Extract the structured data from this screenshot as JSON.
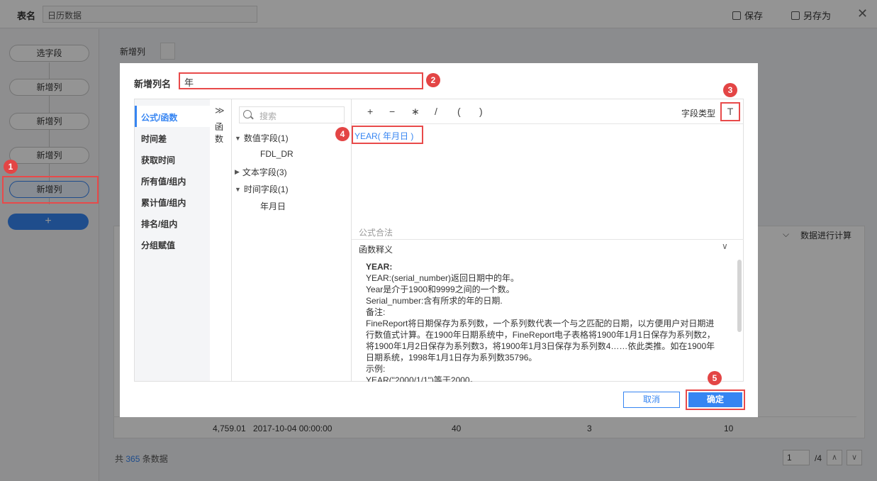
{
  "topbar": {
    "table_label": "表名",
    "table_name": "日历数据",
    "save": "保存",
    "save_as": "另存为",
    "close": "✕"
  },
  "pipeline": {
    "steps": [
      "选字段",
      "新增列",
      "新增列",
      "新增列",
      "新增列"
    ],
    "add": "+"
  },
  "main": {
    "new_col_label": "新增列",
    "dropdown_icon": "⌵",
    "hint": "数据进行计算",
    "visible_row": [
      "4,759.01",
      "2017-10-04 00:00:00",
      "40",
      "3",
      "10"
    ],
    "footer": {
      "prefix": "共",
      "count": "365",
      "suffix": "条数据",
      "page": "1",
      "total": "/4"
    }
  },
  "dialog": {
    "name_label": "新增列名",
    "name_value": "年",
    "categories": [
      "公式/函数",
      "时间差",
      "获取时间",
      "所有值/组内",
      "累计值/组内",
      "排名/组内",
      "分组赋值"
    ],
    "func_chars": [
      "函",
      "数"
    ],
    "expand": "≫",
    "search_placeholder": "搜索",
    "tree": {
      "numeric": "数值字段(1)",
      "numeric_child": "FDL_DR",
      "text": "文本字段(3)",
      "time": "时间字段(1)",
      "time_child": "年月日"
    },
    "operators": [
      "+",
      "−",
      "∗",
      "/",
      "(",
      ")"
    ],
    "field_type_label": "字段类型",
    "field_type_icon": "T",
    "formula": "YEAR( 年月日 )",
    "formula_status": "公式合法",
    "doc_title": "函数释义",
    "doc_lines": [
      "YEAR:",
      "YEAR:(serial_number)返回日期中的年。",
      "Year是介于1900和9999之间的一个数。",
      "Serial_number:含有所求的年的日期.",
      "备注:",
      "FineReport将日期保存为系列数，一个系列数代表一个与之匹配的日期，以方便用户对日期进",
      "行数值式计算。在1900年日期系统中，FineReport电子表格将1900年1月1日保存为系列数2，",
      "将1900年1月2日保存为系列数3，将1900年1月3日保存为系列数4……依此类推。如在1900年",
      "日期系统，1998年1月1日存为系列数35796。",
      "示例:",
      "YEAR(\"2000/1/1\")等于2000。"
    ],
    "cancel": "取消",
    "ok": "确定"
  },
  "markers": [
    "1",
    "2",
    "3",
    "4",
    "5"
  ],
  "colors": {
    "accent": "#3685f2",
    "highlight": "#e84a4a"
  }
}
